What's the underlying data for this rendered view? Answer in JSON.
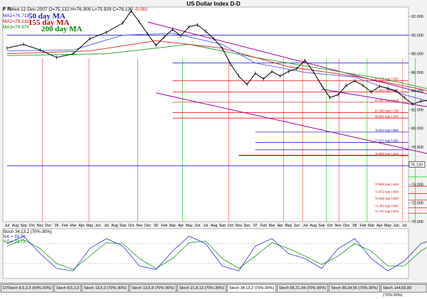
{
  "window": {
    "title": "US Dollar Index  D-D",
    "fr_label": "F R"
  },
  "header": {
    "date": "Wed 12-Dec-2007",
    "open": "75.132",
    "high": "76.309",
    "low": "75.929",
    "close": "76.130",
    "change": "-0.092"
  },
  "ma_readouts": [
    {
      "name": "MA1",
      "value": "=76.713",
      "color": "#2222cc"
    },
    {
      "name": "MA2",
      "value": "=79.132",
      "color": "#cc0000"
    },
    {
      "name": "MA3",
      "value": "=79.976",
      "color": "#008800"
    }
  ],
  "ma_labels": [
    {
      "text": "50 day MA",
      "color": "#2222cc"
    },
    {
      "text": "155 day MA",
      "color": "#cc0000"
    },
    {
      "text": "200 day MA",
      "color": "#008800"
    }
  ],
  "stoch_legend": {
    "title": "Stoch 34,13,2 (70%-30%)",
    "k": "%K = 39.74",
    "d": "%D = 23.73"
  },
  "tabs": [
    "D7Stoch 8,5,3,3 (60%-20%)",
    "Stoch 8,5,3,3",
    "Stoch 13,5,3 (70%-30%)",
    "Stoch 13,5,8 (70%-30%)",
    "Stoch 21,8,13 (70%-30%)",
    "Stoch 34,13,2 (70%-30%)",
    "Stoch 55,21,34 (70%-30%)",
    "Stoch 89,34,55 (70%-30%)",
    "Stoch 144,55,89 (70%-30%)"
  ],
  "active_tab": 5,
  "colors": {
    "price": "#000000",
    "ma50": "#5555ee",
    "ma155": "#cc2222",
    "ma200": "#229922",
    "channel": "#990099",
    "fib_red": "#dd0000",
    "fib_blue": "#0000cc",
    "vert_green": "#00cc00",
    "vert_red": "#ff3333"
  },
  "chart_data": {
    "type": "line",
    "title": "US Dollar Index  D-D",
    "price_axis": {
      "min": 70,
      "max": 93,
      "ticks": [
        "92.000",
        "90.000",
        "88.000",
        "86.000",
        "84.000",
        "82.000",
        "80.000",
        "78.000",
        "76.000",
        "74.000",
        "72.000",
        "70.000"
      ],
      "last_price_label": "76.130"
    },
    "time_axis": [
      "Jul",
      "Aug",
      "Sep",
      "Oct",
      "Nov",
      "Dec",
      "05",
      "Feb",
      "Mar",
      "Apr",
      "May",
      "Jun",
      "Jul",
      "Aug",
      "Sep",
      "Oct",
      "Nov",
      "Dec",
      "06",
      "Feb",
      "Mar",
      "Apr",
      "May",
      "Jun",
      "Jul",
      "Aug",
      "Sep",
      "Oct",
      "Nov",
      "Dec",
      "07",
      "Feb",
      "Mar",
      "Apr",
      "May",
      "Jun",
      "Jul",
      "Aug",
      "Sep",
      "Oct",
      "Nov",
      "Dec",
      "08",
      "Feb",
      "Mar",
      "Apr",
      "May",
      "Jun",
      "Jul"
    ],
    "price_path": [
      [
        0,
        88.6
      ],
      [
        2,
        89.0
      ],
      [
        4,
        88.4
      ],
      [
        6,
        87.6
      ],
      [
        8,
        88.0
      ],
      [
        10,
        89.6
      ],
      [
        12,
        90.3
      ],
      [
        14,
        91.3
      ],
      [
        15,
        92.6
      ],
      [
        16,
        91.4
      ],
      [
        17,
        90.1
      ],
      [
        18,
        88.9
      ],
      [
        19,
        89.8
      ],
      [
        20,
        90.6
      ],
      [
        21,
        89.9
      ],
      [
        22,
        90.9
      ],
      [
        23,
        91.1
      ],
      [
        24,
        90.4
      ],
      [
        25,
        89.6
      ],
      [
        26,
        88.6
      ],
      [
        27,
        86.9
      ],
      [
        28,
        85.6
      ],
      [
        29,
        84.7
      ],
      [
        30,
        85.9
      ],
      [
        31,
        85.3
      ],
      [
        32,
        86.1
      ],
      [
        33,
        85.6
      ],
      [
        34,
        86.1
      ],
      [
        35,
        86.4
      ],
      [
        36,
        87.3
      ],
      [
        37,
        86.1
      ],
      [
        38,
        84.6
      ],
      [
        39,
        83.3
      ],
      [
        40,
        83.6
      ],
      [
        41,
        84.6
      ],
      [
        42,
        85.1
      ],
      [
        43,
        84.6
      ],
      [
        44,
        83.9
      ],
      [
        45,
        84.5
      ],
      [
        46,
        84.3
      ],
      [
        47,
        84.0
      ],
      [
        48,
        83.3
      ],
      [
        49,
        82.6
      ],
      [
        50,
        82.9
      ],
      [
        51,
        83.0
      ],
      [
        52,
        82.3
      ],
      [
        53,
        82.1
      ],
      [
        54,
        81.6
      ],
      [
        55,
        81.0
      ],
      [
        56,
        80.6
      ],
      [
        57,
        80.8
      ],
      [
        58,
        81.0
      ],
      [
        59,
        80.5
      ],
      [
        60,
        79.2
      ],
      [
        61,
        78.0
      ],
      [
        62,
        77.0
      ],
      [
        63,
        76.6
      ],
      [
        64,
        75.6
      ],
      [
        65,
        75.0
      ],
      [
        66,
        75.9
      ],
      [
        67,
        76.1
      ]
    ],
    "ma50_path": [
      [
        0,
        88.3
      ],
      [
        8,
        88.4
      ],
      [
        14,
        90.0
      ],
      [
        20,
        90.2
      ],
      [
        26,
        89.0
      ],
      [
        30,
        87.0
      ],
      [
        36,
        86.0
      ],
      [
        42,
        85.5
      ],
      [
        48,
        83.6
      ],
      [
        54,
        82.2
      ],
      [
        58,
        81.2
      ],
      [
        62,
        79.6
      ],
      [
        66,
        77.4
      ],
      [
        67,
        76.7
      ]
    ],
    "ma155_path": [
      [
        0,
        88.0
      ],
      [
        10,
        88.3
      ],
      [
        18,
        89.4
      ],
      [
        26,
        88.6
      ],
      [
        34,
        86.6
      ],
      [
        42,
        85.6
      ],
      [
        50,
        84.2
      ],
      [
        56,
        82.6
      ],
      [
        62,
        81.0
      ],
      [
        66,
        79.5
      ],
      [
        67,
        79.1
      ]
    ],
    "ma200_path": [
      [
        0,
        87.8
      ],
      [
        12,
        88.0
      ],
      [
        22,
        89.0
      ],
      [
        30,
        87.6
      ],
      [
        38,
        86.4
      ],
      [
        46,
        85.2
      ],
      [
        54,
        83.6
      ],
      [
        60,
        82.2
      ],
      [
        64,
        80.9
      ],
      [
        67,
        80.0
      ]
    ],
    "channel_upper": [
      [
        17,
        91.4
      ],
      [
        80,
        77.0
      ]
    ],
    "channel_lower": [
      [
        18,
        83.8
      ],
      [
        83,
        70.9
      ]
    ],
    "channel_mid": [
      [
        38,
        84.2
      ],
      [
        80,
        78.0
      ]
    ],
    "resistance_lines": [
      {
        "price": 90.0,
        "color": "blue",
        "from": 0
      },
      {
        "price": 87.0,
        "color": "blue",
        "from": 20
      },
      {
        "price": 85.1,
        "color": "red",
        "from": 20,
        "label": "84.675 App 0.382"
      },
      {
        "price": 83.9,
        "color": "red",
        "from": 20,
        "label": "83.603 App 0.500"
      },
      {
        "price": 82.8,
        "color": "red",
        "from": 20,
        "label": "82.487 App 0.618"
      },
      {
        "price": 81.7,
        "color": "red",
        "from": 20,
        "label": "81.360 App 0.786"
      },
      {
        "price": 81.1,
        "color": "red",
        "from": 20,
        "label": "80.991 App 1.000"
      },
      {
        "price": 79.6,
        "color": "blue",
        "from": 30,
        "label": "78.524 App 0.500"
      },
      {
        "price": 78.5,
        "color": "blue",
        "from": 30,
        "label": "77.677 App 0.382"
      },
      {
        "price": 77.7,
        "color": "blue",
        "from": 30
      },
      {
        "price": 77.1,
        "color": "red",
        "from": 28,
        "label": "76.800 App 1.618"
      },
      {
        "price": 76.0,
        "color": "blue",
        "from": 0
      },
      {
        "price": 74.8,
        "color": "green",
        "from": 64
      },
      {
        "price": 73.8,
        "color": "red",
        "from": 55,
        "label": "73.659 App 2.618"
      },
      {
        "price": 73.0,
        "color": "red",
        "from": 55,
        "label": "72.872 App 2.000"
      },
      {
        "price": 72.3,
        "color": "red",
        "from": 55,
        "label": "72.036 App 3.000"
      },
      {
        "price": 71.5,
        "color": "red",
        "from": 55,
        "label": "71.453 App 3.000"
      },
      {
        "price": 70.9,
        "color": "red",
        "from": 55,
        "label": "71.747 App 2.618"
      }
    ],
    "cycle_markers": [
      {
        "x": 4.3,
        "color": "red"
      },
      {
        "x": 9.9,
        "color": "red"
      },
      {
        "x": 15.8,
        "color": "red"
      },
      {
        "x": 21.2,
        "color": "green"
      },
      {
        "x": 26.8,
        "color": "red"
      },
      {
        "x": 33.4,
        "color": "green"
      },
      {
        "x": 35.7,
        "color": "red"
      },
      {
        "x": 38.6,
        "color": "green"
      },
      {
        "x": 40.1,
        "color": "red"
      },
      {
        "x": 43.5,
        "color": "green"
      },
      {
        "x": 47.8,
        "color": "red"
      },
      {
        "x": 49.3,
        "color": "green"
      },
      {
        "x": 51.6,
        "color": "red"
      },
      {
        "x": 54.4,
        "color": "green"
      },
      {
        "x": 57.2,
        "color": "red"
      },
      {
        "x": 58.7,
        "color": "green"
      },
      {
        "x": 61.0,
        "color": "red"
      },
      {
        "x": 65.6,
        "color": "red"
      }
    ],
    "stochastic": {
      "range": [
        0,
        100
      ],
      "overbought": 70,
      "oversold": 30,
      "k_path": [
        [
          0,
          70
        ],
        [
          2,
          85
        ],
        [
          4,
          50
        ],
        [
          6,
          20
        ],
        [
          8,
          15
        ],
        [
          10,
          60
        ],
        [
          12,
          80
        ],
        [
          14,
          65
        ],
        [
          16,
          25
        ],
        [
          18,
          18
        ],
        [
          20,
          55
        ],
        [
          22,
          85
        ],
        [
          24,
          70
        ],
        [
          26,
          25
        ],
        [
          28,
          15
        ],
        [
          30,
          65
        ],
        [
          32,
          80
        ],
        [
          34,
          50
        ],
        [
          36,
          40
        ],
        [
          38,
          20
        ],
        [
          40,
          60
        ],
        [
          42,
          80
        ],
        [
          44,
          40
        ],
        [
          46,
          15
        ],
        [
          48,
          35
        ],
        [
          50,
          70
        ],
        [
          52,
          80
        ],
        [
          54,
          40
        ],
        [
          56,
          20
        ],
        [
          58,
          40
        ],
        [
          60,
          55
        ],
        [
          62,
          45
        ],
        [
          63,
          20
        ],
        [
          64,
          15
        ],
        [
          65,
          10
        ],
        [
          66,
          25
        ],
        [
          67,
          40
        ]
      ],
      "d_path": [
        [
          0,
          65
        ],
        [
          2,
          78
        ],
        [
          4,
          60
        ],
        [
          6,
          30
        ],
        [
          8,
          18
        ],
        [
          10,
          45
        ],
        [
          12,
          72
        ],
        [
          14,
          70
        ],
        [
          16,
          40
        ],
        [
          18,
          20
        ],
        [
          20,
          40
        ],
        [
          22,
          72
        ],
        [
          24,
          75
        ],
        [
          26,
          40
        ],
        [
          28,
          20
        ],
        [
          30,
          45
        ],
        [
          32,
          72
        ],
        [
          34,
          60
        ],
        [
          36,
          45
        ],
        [
          38,
          28
        ],
        [
          40,
          45
        ],
        [
          42,
          70
        ],
        [
          44,
          55
        ],
        [
          46,
          25
        ],
        [
          48,
          25
        ],
        [
          50,
          55
        ],
        [
          52,
          75
        ],
        [
          54,
          55
        ],
        [
          56,
          28
        ],
        [
          58,
          32
        ],
        [
          60,
          48
        ],
        [
          62,
          50
        ],
        [
          63,
          30
        ],
        [
          64,
          20
        ],
        [
          65,
          15
        ],
        [
          66,
          18
        ],
        [
          67,
          23
        ]
      ],
      "k_last": 39.74,
      "d_last": 23.73
    }
  }
}
